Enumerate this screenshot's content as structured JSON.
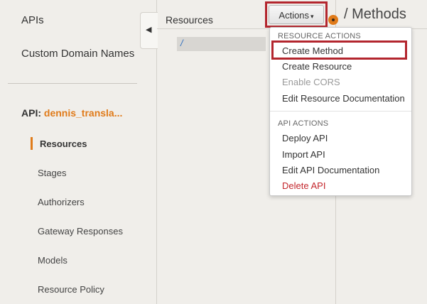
{
  "sidebar": {
    "top_links": [
      {
        "label": "APIs"
      },
      {
        "label": "Custom Domain Names"
      }
    ],
    "api_prefix": "API:",
    "api_name": "dennis_transla...",
    "sub_items": [
      {
        "label": "Resources",
        "active": true
      },
      {
        "label": "Stages"
      },
      {
        "label": "Authorizers"
      },
      {
        "label": "Gateway Responses"
      },
      {
        "label": "Models"
      },
      {
        "label": "Resource Policy"
      }
    ],
    "collapse_icon": "chevron-left-icon"
  },
  "resources_panel": {
    "title": "Resources",
    "root_path": "/"
  },
  "actions_button": {
    "label": "Actions",
    "caret": "▾"
  },
  "methods_title": "/ Methods",
  "actions_menu": {
    "resource_header": "RESOURCE ACTIONS",
    "resource_items": [
      {
        "label": "Create Method",
        "state": "highlighted"
      },
      {
        "label": "Create Resource",
        "state": "normal"
      },
      {
        "label": "Enable CORS",
        "state": "disabled"
      },
      {
        "label": "Edit Resource Documentation",
        "state": "normal"
      }
    ],
    "api_header": "API ACTIONS",
    "api_items": [
      {
        "label": "Deploy API",
        "state": "normal"
      },
      {
        "label": "Import API",
        "state": "normal"
      },
      {
        "label": "Edit API Documentation",
        "state": "normal"
      },
      {
        "label": "Delete API",
        "state": "danger"
      }
    ]
  },
  "colors": {
    "accent_orange": "#e07b1a",
    "highlight_red": "#b3262e",
    "danger_red": "#c3252b",
    "link_blue": "#2e6fbf"
  }
}
